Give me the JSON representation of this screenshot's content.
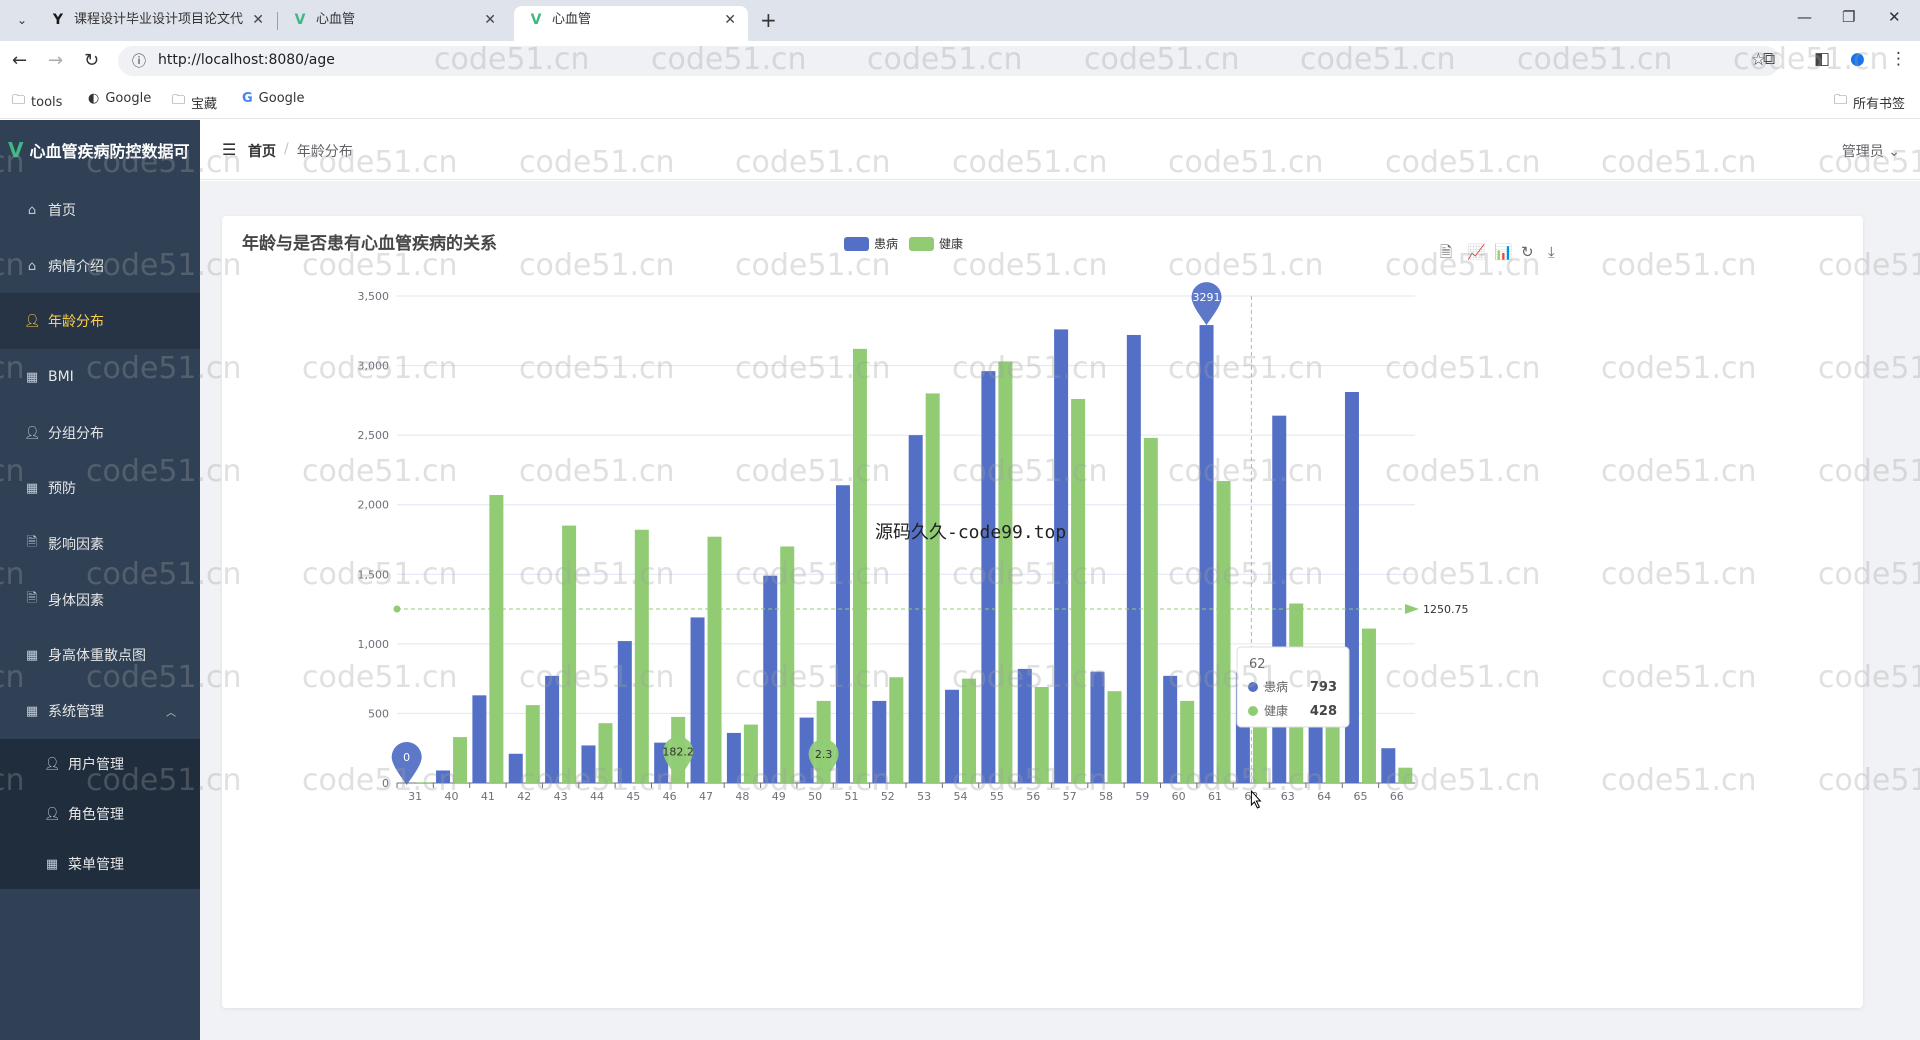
{
  "browser": {
    "tabs": [
      {
        "title": "课程设计毕业设计项目论文代写",
        "icon": "Y",
        "active": false
      },
      {
        "title": "心血管",
        "icon": "V",
        "active": false
      },
      {
        "title": "心血管",
        "icon": "V",
        "active": true
      }
    ],
    "url": "http://localhost:8080/age",
    "bookmarks": [
      "tools",
      "Google",
      "宝藏",
      "Google"
    ],
    "all_bookmarks": "所有书签"
  },
  "app": {
    "title": "心血管疾病防控数据可",
    "menu": [
      {
        "label": "首页",
        "icon": "home-icon"
      },
      {
        "label": "病情介绍",
        "icon": "home-icon"
      },
      {
        "label": "年龄分布",
        "icon": "user-icon",
        "active": true
      },
      {
        "label": "BMI",
        "icon": "grid-icon"
      },
      {
        "label": "分组分布",
        "icon": "user-icon"
      },
      {
        "label": "预防",
        "icon": "grid-icon"
      },
      {
        "label": "影响因素",
        "icon": "document-icon"
      },
      {
        "label": "身体因素",
        "icon": "document-icon"
      },
      {
        "label": "身高体重散点图",
        "icon": "grid-icon"
      },
      {
        "label": "系统管理",
        "icon": "grid-icon",
        "expanded": true
      }
    ],
    "submenu": [
      {
        "label": "用户管理",
        "icon": "user-icon"
      },
      {
        "label": "角色管理",
        "icon": "user-icon"
      },
      {
        "label": "菜单管理",
        "icon": "grid-icon"
      }
    ],
    "breadcrumb": {
      "home": "首页",
      "current": "年龄分布"
    },
    "user": "管理员"
  },
  "watermark": "code51.cn",
  "center_mark": "源码久久-code99.top",
  "chart_data": {
    "type": "bar",
    "title": "年龄与是否患有心血管疾病的关系",
    "categories": [
      "31",
      "40",
      "41",
      "42",
      "43",
      "44",
      "45",
      "46",
      "47",
      "48",
      "49",
      "50",
      "51",
      "52",
      "53",
      "54",
      "55",
      "56",
      "57",
      "58",
      "59",
      "60",
      "61",
      "62",
      "63",
      "64",
      "65",
      "66"
    ],
    "series": [
      {
        "name": "患病",
        "color": "#5470c6",
        "values": [
          0,
          90,
          630,
          210,
          770,
          270,
          1020,
          290,
          1190,
          360,
          1490,
          470,
          2140,
          590,
          2500,
          670,
          2960,
          820,
          3260,
          800,
          3220,
          770,
          3291,
          793,
          2640,
          730,
          2810,
          250
        ]
      },
      {
        "name": "健康",
        "color": "#91cc75",
        "values": [
          5,
          330,
          2070,
          560,
          1850,
          430,
          1820,
          475,
          1770,
          420,
          1700,
          590,
          3120,
          760,
          2800,
          750,
          3030,
          690,
          2760,
          660,
          2480,
          590,
          2170,
          428,
          1290,
          540,
          1110,
          110
        ]
      }
    ],
    "ylim": [
      0,
      3500
    ],
    "yticks": [
      "0",
      "500",
      "1,000",
      "1,500",
      "2,000",
      "2,500",
      "3,000",
      "3,500"
    ],
    "legend": "top-center",
    "mark_points": [
      {
        "label": "3291",
        "series": "患病",
        "category": "61"
      },
      {
        "label": "0",
        "series": "患病",
        "category": "31"
      },
      {
        "label": "182.2",
        "series": "健康",
        "category": "46"
      },
      {
        "label": "2.3",
        "series": "健康",
        "category": "50"
      }
    ],
    "mark_line": {
      "label": "1250.75",
      "value": 1250.75
    },
    "tooltip": {
      "category": "62",
      "rows": [
        {
          "name": "患病",
          "value": "793"
        },
        {
          "name": "健康",
          "value": "428"
        }
      ]
    }
  }
}
